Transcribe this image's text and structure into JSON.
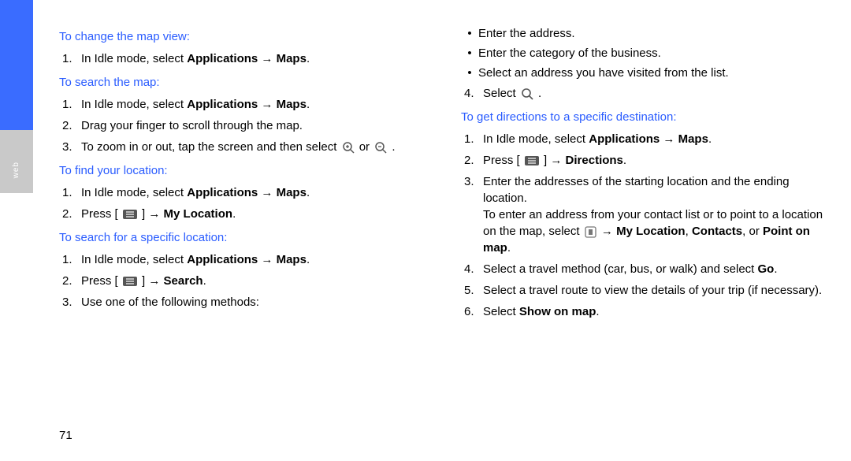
{
  "sideTab": "web",
  "pageNumber": "71",
  "left": {
    "h1": "To change the map view:",
    "l1": [
      "1.",
      "In Idle mode, select ",
      "Applications → Maps",
      "."
    ],
    "h2": "To search the map:",
    "l2": [
      "1.",
      "In Idle mode, select ",
      "Applications → Maps",
      "."
    ],
    "l3": [
      "2.",
      "Drag your finger to scroll through the map."
    ],
    "l4a": [
      "3.",
      "To zoom in or out, tap the screen and then select "
    ],
    "l4b": " or ",
    "l4c": ".",
    "h3": "To find your location:",
    "l5": [
      "1.",
      "In Idle mode, select ",
      "Applications → Maps",
      "."
    ],
    "l6a": [
      "2.",
      "Press [ "
    ],
    "l6b": " ] → ",
    "l6c": "My Location",
    "l6d": ".",
    "h4": "To search for a specific location:",
    "l7": [
      "1.",
      "In Idle mode, select ",
      "Applications → Maps",
      "."
    ],
    "l8a": [
      "2.",
      "Press [ "
    ],
    "l8b": " ] → ",
    "l8c": "Search",
    "l8d": ".",
    "l9": [
      "3.",
      "Use one of the following methods:"
    ]
  },
  "right": {
    "b1": "Enter the address.",
    "b2": "Enter the category of the business.",
    "b3": "Select an address you have visited from the list.",
    "l1a": [
      "4.",
      "Select "
    ],
    "l1b": ".",
    "h1": "To get directions to a specific destination:",
    "l2": [
      "1.",
      "In Idle mode, select ",
      "Applications → Maps",
      "."
    ],
    "l3a": [
      "2.",
      "Press [ "
    ],
    "l3b": " ] → ",
    "l3c": "Directions",
    "l3d": ".",
    "l4": [
      "3.",
      "Enter the addresses of the starting location and the ending location."
    ],
    "l4suba": "To enter an address from your contact list or to point to a location on the map, select ",
    "l4subb": " → ",
    "l4subc": "My Location",
    "l4subd": ", ",
    "l4sube": "Contacts",
    "l4subf": ", or ",
    "l4subg": "Point on map",
    "l4subh": ".",
    "l5a": [
      "4.",
      "Select a travel method (car, bus, or walk) and select "
    ],
    "l5b": "Go",
    "l5c": ".",
    "l6": [
      "5.",
      "Select a travel route to view the details of your trip (if necessary)."
    ],
    "l7a": [
      "6.",
      "Select "
    ],
    "l7b": "Show on map",
    "l7c": "."
  }
}
